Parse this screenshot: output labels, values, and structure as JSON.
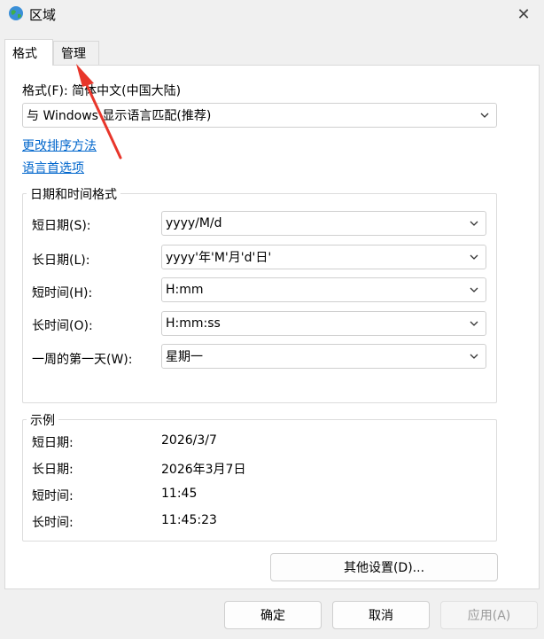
{
  "window": {
    "title": "区域",
    "close": "✕"
  },
  "tabs": [
    {
      "label": "格式",
      "active": true
    },
    {
      "label": "管理",
      "active": false
    }
  ],
  "format": {
    "label": "格式(F): 简体中文(中国大陆)",
    "value": "与 Windows 显示语言匹配(推荐)",
    "link_sort": "更改排序方法",
    "link_lang": "语言首选项"
  },
  "datetime": {
    "title": "日期和时间格式",
    "rows": [
      {
        "label": "短日期(S):",
        "value": "yyyy/M/d"
      },
      {
        "label": "长日期(L):",
        "value": "yyyy'年'M'月'd'日'"
      },
      {
        "label": "短时间(H):",
        "value": "H:mm"
      },
      {
        "label": "长时间(O):",
        "value": "H:mm:ss"
      },
      {
        "label": "一周的第一天(W):",
        "value": "星期一"
      }
    ]
  },
  "examples": {
    "title": "示例",
    "rows": [
      {
        "label": "短日期:",
        "value": "2026/3/7"
      },
      {
        "label": "长日期:",
        "value": "2026年3月7日"
      },
      {
        "label": "短时间:",
        "value": "11:45"
      },
      {
        "label": "长时间:",
        "value": "11:45:23"
      }
    ]
  },
  "buttons": {
    "other": "其他设置(D)...",
    "ok": "确定",
    "cancel": "取消",
    "apply": "应用(A)"
  },
  "colors": {
    "link": "#0066cc",
    "arrow": "#e8362b"
  }
}
